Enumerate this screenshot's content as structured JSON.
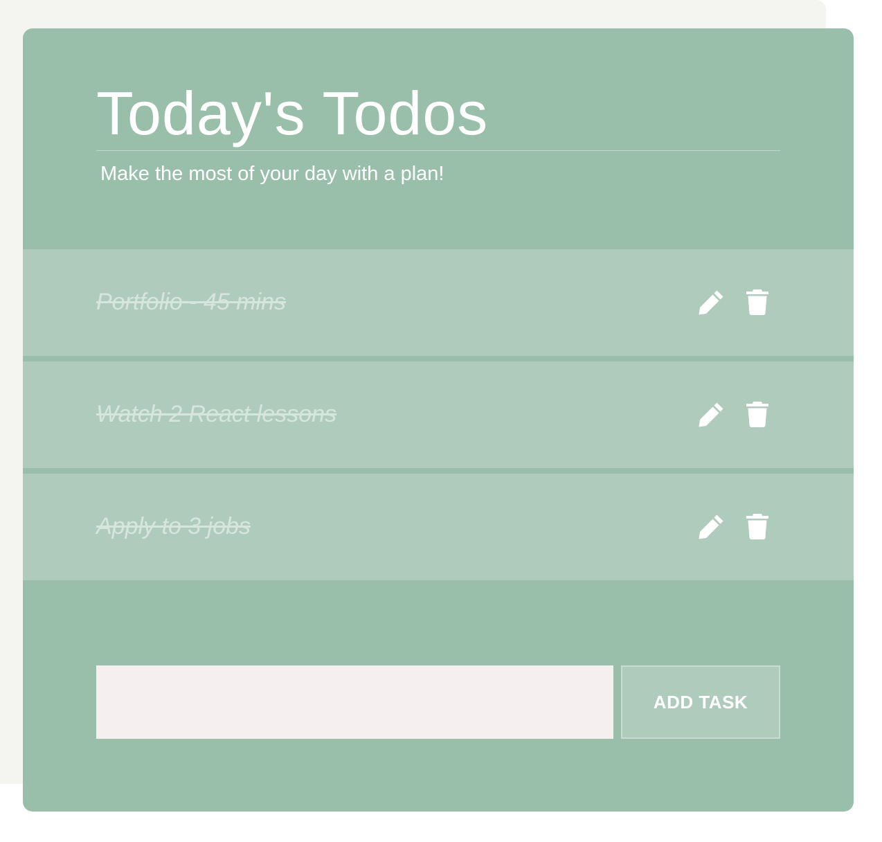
{
  "header": {
    "title": "Today's Todos",
    "subtitle": "Make the most of your day with a plan!"
  },
  "todos": [
    {
      "text": "Portfolio - 45 mins",
      "completed": true,
      "edit_icon": "pencil-icon",
      "delete_icon": "trash-icon"
    },
    {
      "text": "Watch 2 React lessons",
      "completed": true,
      "edit_icon": "pencil-icon",
      "delete_icon": "trash-icon"
    },
    {
      "text": "Apply to 3 jobs",
      "completed": true,
      "edit_icon": "pencil-icon",
      "delete_icon": "trash-icon"
    }
  ],
  "add_form": {
    "input_value": "",
    "input_placeholder": "",
    "button_label": "ADD TASK"
  },
  "colors": {
    "card_background": "#99bfab",
    "item_background": "#aecbbc",
    "completed_text": "#d6e6dd",
    "input_background": "#f5efef",
    "page_backdrop": "#f4f5f0"
  }
}
